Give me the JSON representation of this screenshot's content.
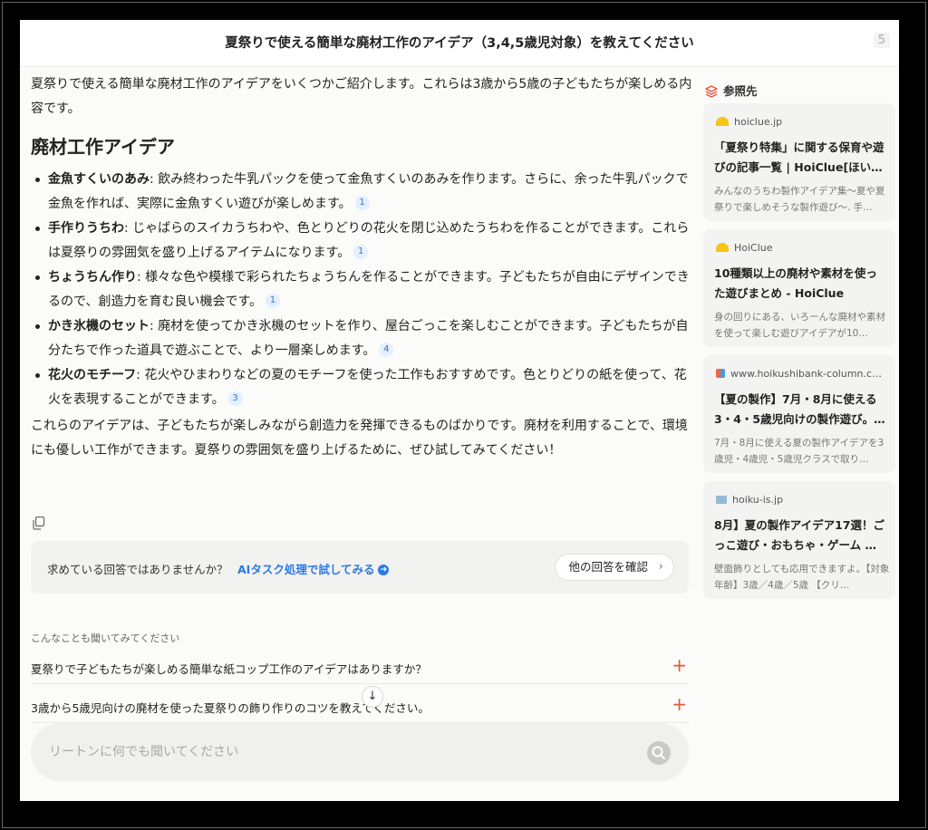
{
  "header": {
    "title": "夏祭りで使える簡単な廃材工作のアイデア（3,4,5歳児対象）を教えてください",
    "count": "5"
  },
  "answer": {
    "intro": "夏祭りで使える簡単な廃材工作のアイデアをいくつかご紹介します。これらは3歳から5歳の子どもたちが楽しめる内容です。",
    "heading": "廃材工作アイデア",
    "bullets": [
      {
        "title": "金魚すくいのあみ",
        "text": ": 飲み終わった牛乳パックを使って金魚すくいのあみを作ります。さらに、余った牛乳パックで金魚を作れば、実際に金魚すくい遊びが楽しめます。",
        "cite": "1"
      },
      {
        "title": "手作りうちわ",
        "text": ": じゃばらのスイカうちわや、色とりどりの花火を閉じ込めたうちわを作ることができます。これらは夏祭りの雰囲気を盛り上げるアイテムになります。",
        "cite": "1"
      },
      {
        "title": "ちょうちん作り",
        "text": ": 様々な色や模様で彩られたちょうちんを作ることができます。子どもたちが自由にデザインできるので、創造力を育む良い機会です。",
        "cite": "1"
      },
      {
        "title": "かき氷機のセット",
        "text": ": 廃材を使ってかき氷機のセットを作り、屋台ごっこを楽しむことができます。子どもたちが自分たちで作った道具で遊ぶことで、より一層楽しめます。",
        "cite": "4"
      },
      {
        "title": "花火のモチーフ",
        "text": ": 花火やひまわりなどの夏のモチーフを使った工作もおすすめです。色とりどりの紙を使って、花火を表現することができます。",
        "cite": "3"
      }
    ],
    "conclusion": "これらのアイデアは、子どもたちが楽しみながら創造力を発揮できるものばかりです。廃材を利用することで、環境にも優しい工作ができます。夏祭りの雰囲気を盛り上げるために、ぜひ試してみてください！"
  },
  "feedback": {
    "question": "求めている回答ではありませんか？",
    "link": "AIタスク処理で試してみる",
    "other_button": "他の回答を確認"
  },
  "related": {
    "label": "こんなことも聞いてみてください",
    "items": [
      "夏祭りで子どもたちが楽しめる簡単な紙コップ工作のアイデアはありますか？",
      "3歳から5歳児向けの廃材を使った夏祭りの飾り作りのコツを教えてください。"
    ]
  },
  "search": {
    "placeholder": "リートンに何でも聞いてください"
  },
  "sources": {
    "heading": "参照先",
    "items": [
      {
        "site": "hoiclue.jp",
        "icon": "yellow-semicircle-favicon",
        "color": "#f5c518",
        "title": "「夏祭り特集」に関する保育や遊びの記事一覧 | HoiClue[ほい…",
        "desc": "みんなのうちわ製作アイデア集～夏や夏祭りで楽しめそうな製作遊び～. 手…"
      },
      {
        "site": "HoiClue",
        "icon": "yellow-semicircle-favicon",
        "color": "#f5c518",
        "title": "10種類以上の廃材や素材を使った遊びまとめ - HoiClue",
        "desc": "身の回りにある、いろーんな廃材や素材を使って楽しむ遊びアイデアが10…"
      },
      {
        "site": "www.hoikushibank-column.c…",
        "icon": "multicolor-favicon",
        "color": "#e86a4a",
        "title": "【夏の製作】7月・8月に使える3・4・5歳児向けの製作遊び。…",
        "desc": "7月・8月に使える夏の製作アイデアを3歳児・4歳児・5歳児クラスで取り…"
      },
      {
        "site": "hoiku-is.jp",
        "icon": "image-favicon",
        "color": "#9ab8d8",
        "title": "8月】夏の製作アイデア17選！ごっこ遊び・おもちゃ・ゲーム …",
        "desc": "壁面飾りとしても応用できますよ。【対象年齢】3歳／4歳／5歳 【クリ…"
      }
    ]
  },
  "colors": {
    "accent_blue": "#2d7ae5",
    "plus_red": "#e05a3a",
    "sources_icon": "#e0553a"
  }
}
